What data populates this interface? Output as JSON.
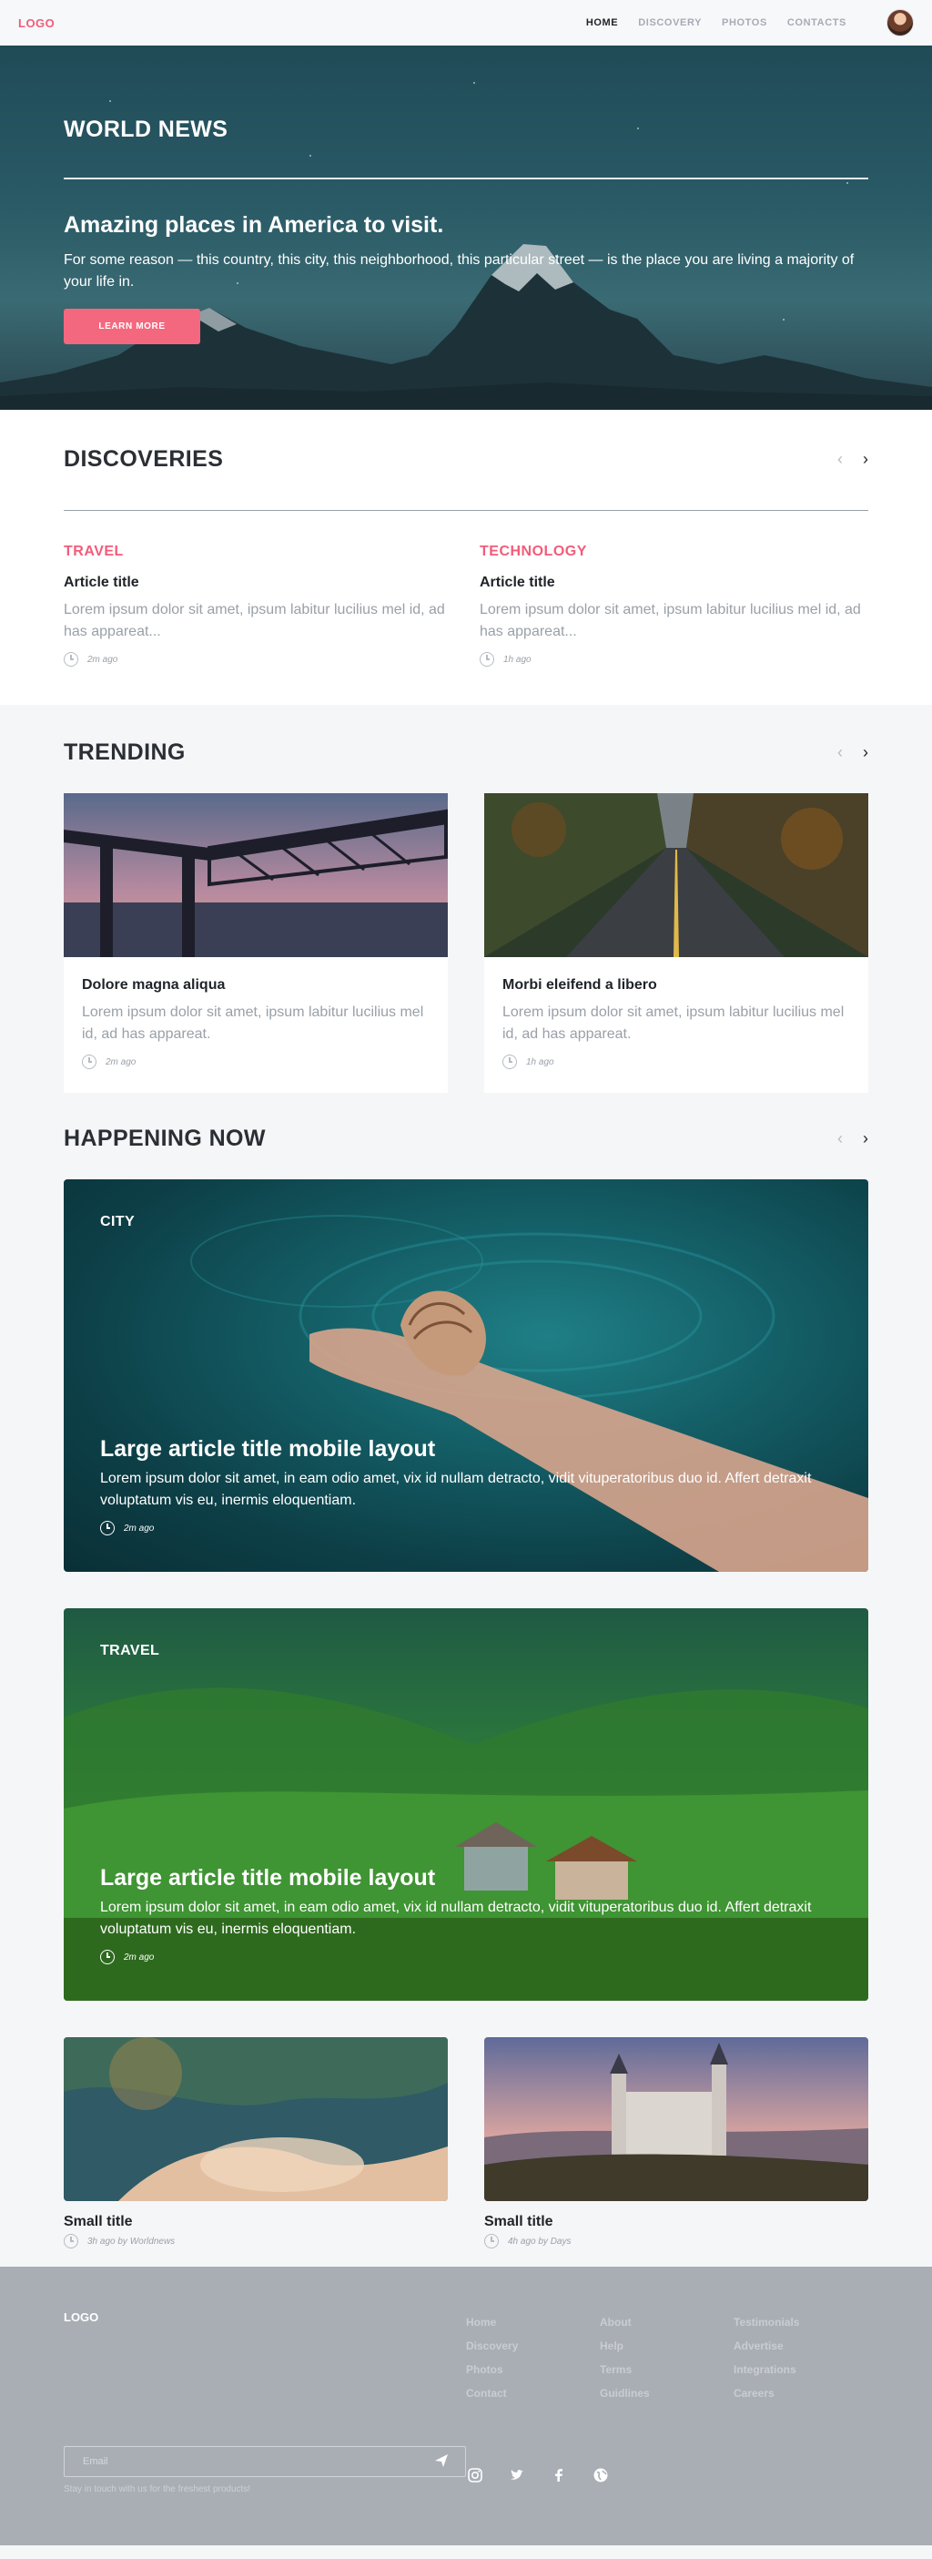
{
  "header": {
    "logo": "LOGO",
    "nav": [
      "HOME",
      "DISCOVERY",
      "PHOTOS",
      "CONTACTS"
    ]
  },
  "hero": {
    "section_title": "WORLD NEWS",
    "headline": "Amazing places in America to visit.",
    "text": "For some reason — this country, this city, this neighborhood, this particular street — is the place you are living a majority of your life in.",
    "button": "LEARN MORE"
  },
  "discoveries": {
    "title": "DISCOVERIES",
    "items": [
      {
        "category": "TRAVEL",
        "title": "Article title",
        "text": "Lorem ipsum dolor sit amet, ipsum labitur lucilius mel id, ad has appareat...",
        "time": "2m ago"
      },
      {
        "category": "TECHNOLOGY",
        "title": "Article title",
        "text": "Lorem ipsum dolor sit amet, ipsum labitur lucilius mel id, ad has appareat...",
        "time": "1h ago"
      }
    ]
  },
  "trending": {
    "title": "TRENDING",
    "items": [
      {
        "title": "Dolore magna aliqua",
        "text": "Lorem ipsum dolor sit amet, ipsum labitur lucilius mel id, ad has appareat.",
        "time": "2m ago"
      },
      {
        "title": "Morbi eleifend a libero",
        "text": "Lorem ipsum dolor sit amet, ipsum labitur lucilius mel id, ad has appareat.",
        "time": "1h ago"
      }
    ]
  },
  "happening": {
    "title": "HAPPENING NOW",
    "big": [
      {
        "tag": "CITY",
        "title": "Large article title mobile layout",
        "text": "Lorem ipsum dolor sit amet, in eam odio amet, vix id nullam detracto, vidit vituperatoribus duo id. Affert detraxit voluptatum vis eu, inermis eloquentiam.",
        "time": "2m ago"
      },
      {
        "tag": "TRAVEL",
        "title": "Large article title mobile layout",
        "text": "Lorem ipsum dolor sit amet, in eam odio amet, vix id nullam detracto, vidit vituperatoribus duo id. Affert detraxit voluptatum vis eu, inermis eloquentiam.",
        "time": "2m ago"
      }
    ],
    "small": [
      {
        "title": "Small title",
        "meta": "3h ago by Worldnews"
      },
      {
        "title": "Small title",
        "meta": "4h ago by Days"
      }
    ]
  },
  "footer": {
    "logo": "LOGO",
    "col1": [
      "Home",
      "Discovery",
      "Photos",
      "Contact"
    ],
    "col2": [
      "About",
      "Help",
      "Terms",
      "Guidlines"
    ],
    "col3": [
      "Testimonials",
      "Advertise",
      "Integrations",
      "Careers"
    ],
    "email_placeholder": "Email",
    "hint": "Stay in touch with us for the freshest products!",
    "socials": [
      "instagram-icon",
      "twitter-icon",
      "facebook-icon",
      "globe-icon"
    ]
  },
  "colors": {
    "accent": "#f25c7a",
    "footer_bg": "#a9aeb5"
  }
}
